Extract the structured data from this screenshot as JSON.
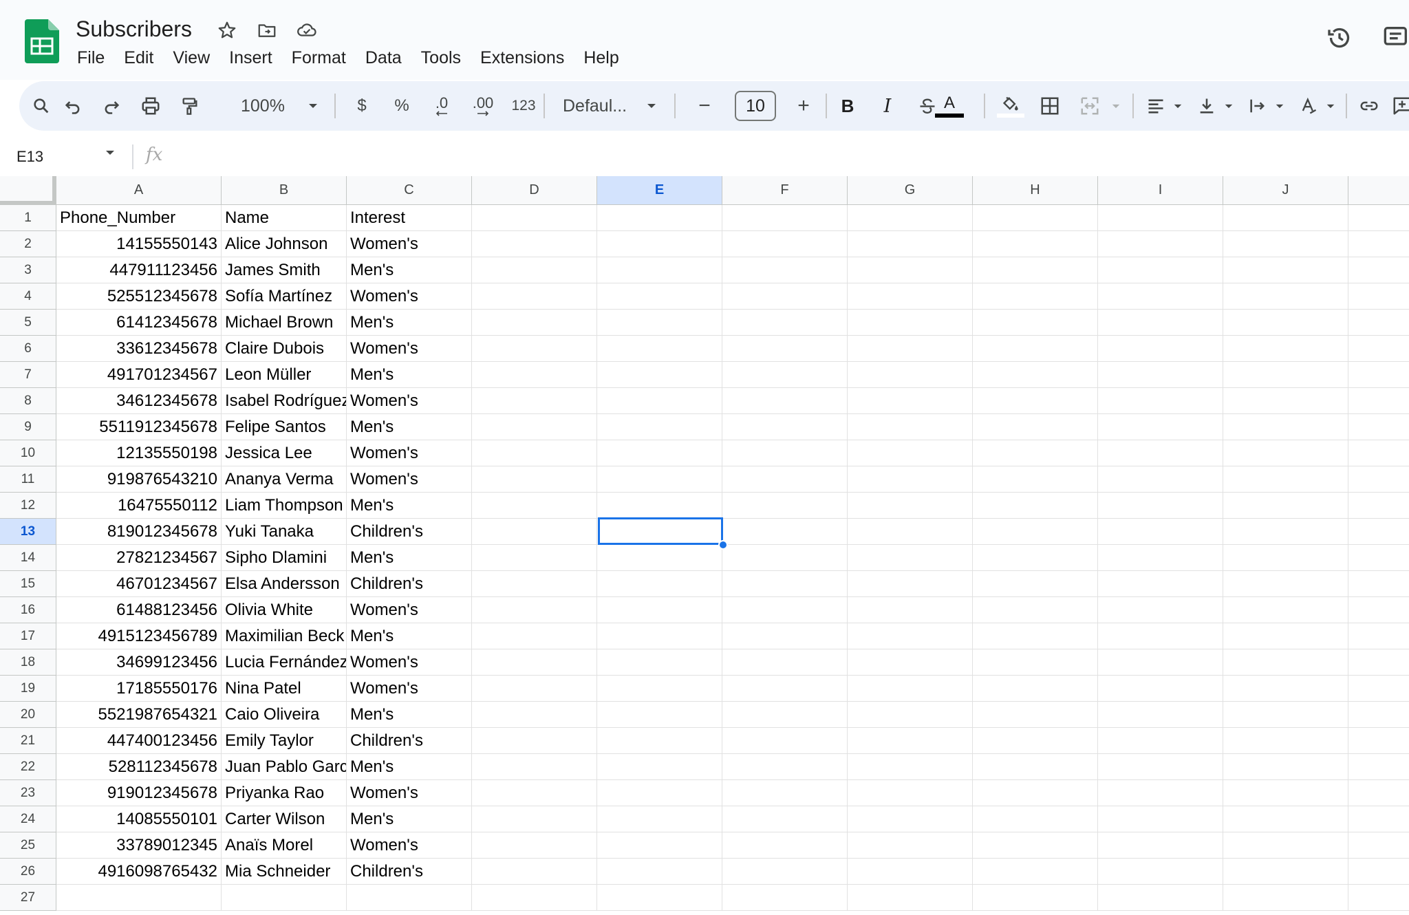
{
  "document": {
    "title": "Subscribers"
  },
  "menu": [
    "File",
    "Edit",
    "View",
    "Insert",
    "Format",
    "Data",
    "Tools",
    "Extensions",
    "Help"
  ],
  "toolbar": {
    "zoom": "100%",
    "currency_label": "$",
    "percent_label": "%",
    "decrease_decimal_label": ".0",
    "increase_decimal_label": ".00",
    "number_format_label": "123",
    "font_name": "Defaul...",
    "font_size": "10",
    "minus_label": "−",
    "plus_label": "+",
    "bold_label": "B",
    "italic_label": "I",
    "text_color_label": "A"
  },
  "formula_bar": {
    "cell_ref": "E13",
    "fx_label": "fx",
    "content": ""
  },
  "colors": {
    "accent": "#1a73e8",
    "logo_green": "#0f9d58",
    "toolbar_bg": "#edf2fa",
    "header_active": "#d3e3fd"
  },
  "sheet": {
    "columns": [
      "A",
      "B",
      "C",
      "D",
      "E",
      "F",
      "G",
      "H",
      "I",
      "J"
    ],
    "active_column": "E",
    "active_row": "13",
    "row_numbers": [
      "1",
      "2",
      "3",
      "4",
      "5",
      "6",
      "7",
      "8",
      "9",
      "10",
      "11",
      "12",
      "13",
      "14",
      "15",
      "16",
      "17",
      "18",
      "19",
      "20",
      "21",
      "22",
      "23",
      "24",
      "25",
      "26",
      "27"
    ],
    "rows": [
      [
        "Phone_Number",
        "Name",
        "Interest"
      ],
      [
        "14155550143",
        "Alice Johnson",
        "Women's"
      ],
      [
        "447911123456",
        "James Smith",
        "Men's"
      ],
      [
        "525512345678",
        "Sofía Martínez",
        "Women's"
      ],
      [
        "61412345678",
        "Michael Brown",
        "Men's"
      ],
      [
        "33612345678",
        "Claire Dubois",
        "Women's"
      ],
      [
        "491701234567",
        "Leon Müller",
        "Men's"
      ],
      [
        "34612345678",
        "Isabel Rodríguez",
        "Women's"
      ],
      [
        "5511912345678",
        "Felipe Santos",
        "Men's"
      ],
      [
        "12135550198",
        "Jessica Lee",
        "Women's"
      ],
      [
        "919876543210",
        "Ananya Verma",
        "Women's"
      ],
      [
        "16475550112",
        "Liam Thompson",
        "Men's"
      ],
      [
        "819012345678",
        "Yuki Tanaka",
        "Children's"
      ],
      [
        "27821234567",
        "Sipho Dlamini",
        "Men's"
      ],
      [
        "46701234567",
        "Elsa Andersson",
        "Children's"
      ],
      [
        "61488123456",
        "Olivia White",
        "Women's"
      ],
      [
        "4915123456789",
        "Maximilian Beck",
        "Men's"
      ],
      [
        "34699123456",
        "Lucia Fernández",
        "Women's"
      ],
      [
        "17185550176",
        "Nina Patel",
        "Women's"
      ],
      [
        "5521987654321",
        "Caio Oliveira",
        "Men's"
      ],
      [
        "447400123456",
        "Emily Taylor",
        "Children's"
      ],
      [
        "528112345678",
        "Juan Pablo García",
        "Men's"
      ],
      [
        "919012345678",
        "Priyanka Rao",
        "Women's"
      ],
      [
        "14085550101",
        "Carter Wilson",
        "Men's"
      ],
      [
        "33789012345",
        "Anaïs Morel",
        "Women's"
      ],
      [
        "4916098765432",
        "Mia Schneider",
        "Children's"
      ],
      [
        "",
        "",
        ""
      ]
    ]
  }
}
